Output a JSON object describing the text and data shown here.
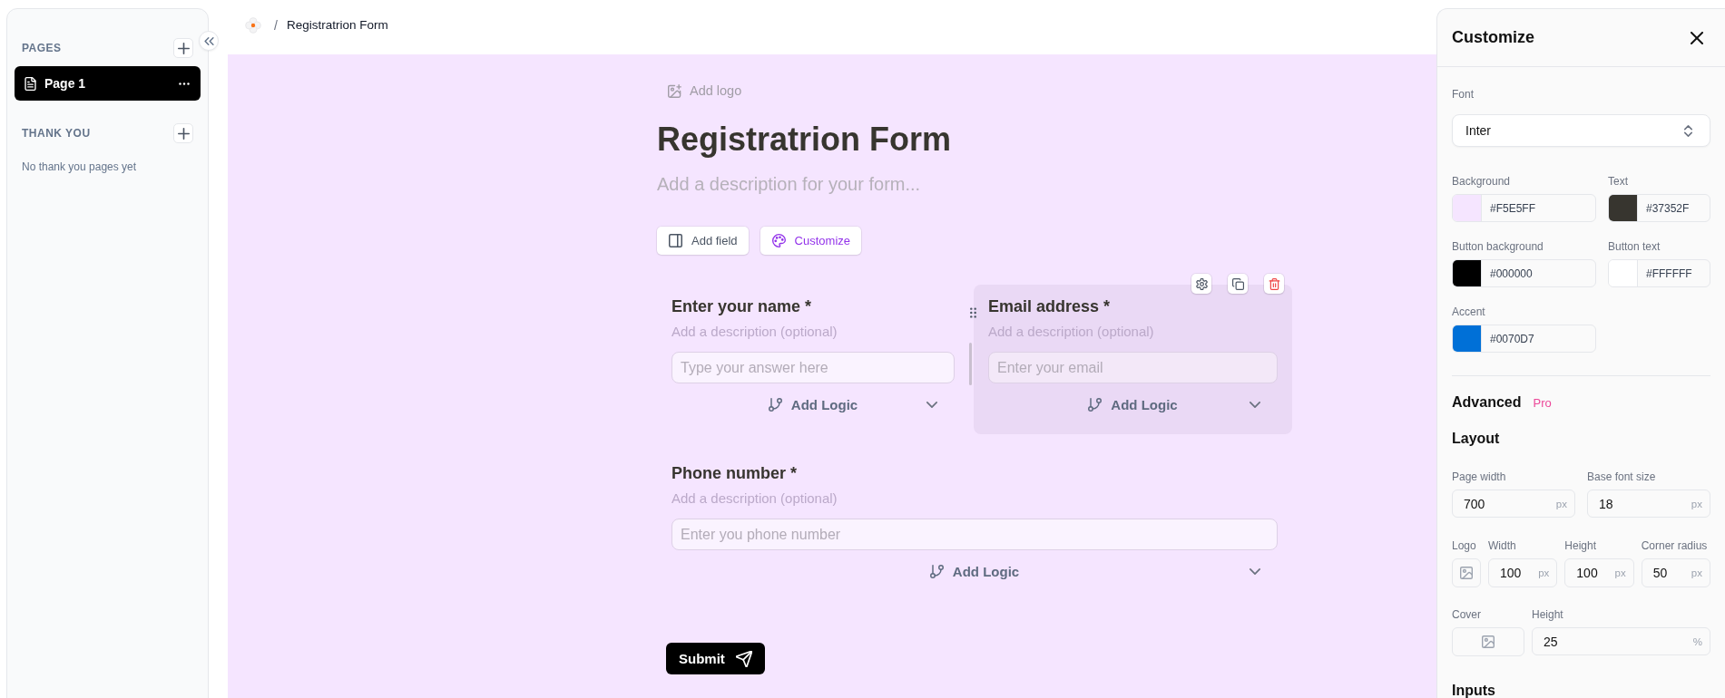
{
  "sidebar": {
    "sections": [
      {
        "title": "PAGES",
        "pages": [
          {
            "label": "Page 1",
            "selected": true
          }
        ]
      },
      {
        "title": "THANK YOU",
        "empty_text": "No thank you pages yet"
      }
    ]
  },
  "breadcrumb": {
    "separator": "/",
    "title": "Registratrion Form"
  },
  "form": {
    "add_logo": "Add logo",
    "title": "Registratrion Form",
    "description_hint": "Add a description for your form...",
    "actions": [
      {
        "kind": "add-field",
        "label": "Add field"
      },
      {
        "kind": "customize",
        "label": "Customize"
      }
    ],
    "rows": [
      {
        "fields": [
          {
            "label": "Enter your name *",
            "description_hint": "Add a description (optional)",
            "placeholder": "Type your answer here",
            "logic": "Add Logic",
            "selected": false
          },
          {
            "label": "Email address *",
            "description_hint": "Add a description (optional)",
            "placeholder": "Enter your email",
            "logic": "Add Logic",
            "selected": true
          }
        ]
      },
      {
        "fields": [
          {
            "label": "Phone number *",
            "description_hint": "Add a description (optional)",
            "placeholder": "Enter you phone number",
            "logic": "Add Logic",
            "selected": false
          }
        ]
      }
    ],
    "submit": "Submit"
  },
  "customize": {
    "title": "Customize",
    "font": {
      "label": "Font",
      "value": "Inter"
    },
    "colors": [
      {
        "label": "Background",
        "value": "#F5E5FF",
        "color": "#f5e5ff"
      },
      {
        "label": "Text",
        "value": "#37352F",
        "color": "#37352f"
      },
      {
        "label": "Button background",
        "value": "#000000",
        "color": "#000000"
      },
      {
        "label": "Button text",
        "value": "#FFFFFF",
        "color": "#ffffff"
      },
      {
        "label": "Accent",
        "value": "#0070D7",
        "color": "#0070d7"
      }
    ],
    "advanced": {
      "title": "Advanced",
      "badge": "Pro"
    },
    "layout": {
      "title": "Layout",
      "sizes": [
        {
          "label": "Page width",
          "value": "700",
          "unit": "px"
        },
        {
          "label": "Base font size",
          "value": "18",
          "unit": "px"
        }
      ],
      "logo": {
        "label": "Logo",
        "sizes": [
          {
            "label": "Width",
            "value": "100",
            "unit": "px"
          },
          {
            "label": "Height",
            "value": "100",
            "unit": "px"
          },
          {
            "label": "Corner radius",
            "value": "50",
            "unit": "px"
          }
        ]
      },
      "cover": {
        "label": "Cover",
        "sizes": [
          {
            "label": "Height",
            "value": "25",
            "unit": "%"
          }
        ]
      }
    },
    "inputs": {
      "title": "Inputs"
    }
  }
}
